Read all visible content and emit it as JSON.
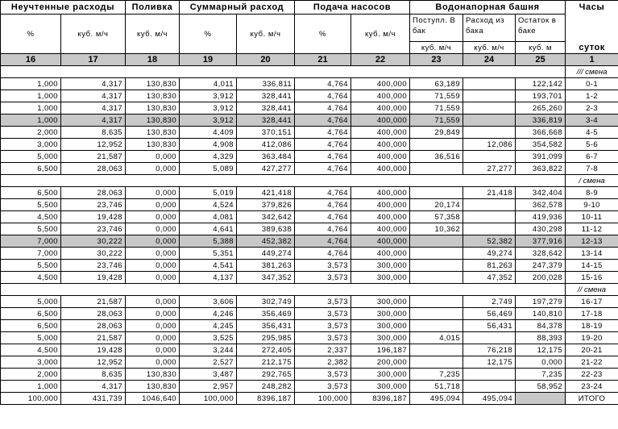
{
  "headers": {
    "unaccounted": "Неучтенные расходы",
    "watering": "Поливка",
    "total_flow": "Суммарный расход",
    "pumps": "Подача насосов",
    "tower": "Водонапорная башня",
    "hours": "Часы",
    "day": "суток",
    "pct": "%",
    "m3h": "куб. м/ч",
    "m3": "куб. м",
    "tower_in": "Поступл. В бак",
    "tower_out": "Расход из бака",
    "tower_rest": "Остаток в баке",
    "column_numbers": [
      "16",
      "17",
      "18",
      "19",
      "20",
      "21",
      "22",
      "23",
      "24",
      "25",
      "1"
    ]
  },
  "shifts": [
    {
      "label": "/// смена",
      "rows": [
        {
          "c16": "1,000",
          "c17": "4,317",
          "c18": "130,830",
          "c19": "4,011",
          "c20": "336,811",
          "c21": "4,764",
          "c22": "400,000",
          "c23": "63,189",
          "c24": "",
          "c25": "122,142",
          "t": "0-1"
        },
        {
          "c16": "1,000",
          "c17": "4,317",
          "c18": "130,830",
          "c19": "3,912",
          "c20": "328,441",
          "c21": "4,764",
          "c22": "400,000",
          "c23": "71,559",
          "c24": "",
          "c25": "193,701",
          "t": "1-2"
        },
        {
          "c16": "1,000",
          "c17": "4,317",
          "c18": "130,830",
          "c19": "3,912",
          "c20": "328,441",
          "c21": "4,764",
          "c22": "400,000",
          "c23": "71,559",
          "c24": "",
          "c25": "265,260",
          "t": "2-3"
        },
        {
          "c16": "1,000",
          "c17": "4,317",
          "c18": "130,830",
          "c19": "3,912",
          "c20": "328,441",
          "c21": "4,764",
          "c22": "400,000",
          "c23": "71,559",
          "c24": "",
          "c25": "336,819",
          "t": "3-4",
          "hl": true
        },
        {
          "c16": "2,000",
          "c17": "8,635",
          "c18": "130,830",
          "c19": "4,409",
          "c20": "370,151",
          "c21": "4,764",
          "c22": "400,000",
          "c23": "29,849",
          "c24": "",
          "c25": "366,668",
          "t": "4-5"
        },
        {
          "c16": "3,000",
          "c17": "12,952",
          "c18": "130,830",
          "c19": "4,908",
          "c20": "412,086",
          "c21": "4,764",
          "c22": "400,000",
          "c23": "",
          "c24": "12,086",
          "c25": "354,582",
          "t": "5-6"
        },
        {
          "c16": "5,000",
          "c17": "21,587",
          "c18": "0,000",
          "c19": "4,329",
          "c20": "363,484",
          "c21": "4,764",
          "c22": "400,000",
          "c23": "36,516",
          "c24": "",
          "c25": "391,099",
          "t": "6-7"
        },
        {
          "c16": "6,500",
          "c17": "28,063",
          "c18": "0,000",
          "c19": "5,089",
          "c20": "427,277",
          "c21": "4,764",
          "c22": "400,000",
          "c23": "",
          "c24": "27,277",
          "c25": "363,822",
          "t": "7-8"
        }
      ]
    },
    {
      "label": "/ смена",
      "rows": [
        {
          "c16": "6,500",
          "c17": "28,063",
          "c18": "0,000",
          "c19": "5,019",
          "c20": "421,418",
          "c21": "4,764",
          "c22": "400,000",
          "c23": "",
          "c24": "21,418",
          "c25": "342,404",
          "t": "8-9"
        },
        {
          "c16": "5,500",
          "c17": "23,746",
          "c18": "0,000",
          "c19": "4,524",
          "c20": "379,826",
          "c21": "4,764",
          "c22": "400,000",
          "c23": "20,174",
          "c24": "",
          "c25": "362,578",
          "t": "9-10"
        },
        {
          "c16": "4,500",
          "c17": "19,428",
          "c18": "0,000",
          "c19": "4,081",
          "c20": "342,642",
          "c21": "4,764",
          "c22": "400,000",
          "c23": "57,358",
          "c24": "",
          "c25": "419,936",
          "t": "10-11"
        },
        {
          "c16": "5,500",
          "c17": "23,746",
          "c18": "0,000",
          "c19": "4,641",
          "c20": "389,638",
          "c21": "4,764",
          "c22": "400,000",
          "c23": "10,362",
          "c24": "",
          "c25": "430,298",
          "t": "11-12"
        },
        {
          "c16": "7,000",
          "c17": "30,222",
          "c18": "0,000",
          "c19": "5,388",
          "c20": "452,382",
          "c21": "4,764",
          "c22": "400,000",
          "c23": "",
          "c24": "52,382",
          "c25": "377,916",
          "t": "12-13",
          "hl": true
        },
        {
          "c16": "7,000",
          "c17": "30,222",
          "c18": "0,000",
          "c19": "5,351",
          "c20": "449,274",
          "c21": "4,764",
          "c22": "400,000",
          "c23": "",
          "c24": "49,274",
          "c25": "328,642",
          "t": "13-14"
        },
        {
          "c16": "5,500",
          "c17": "23,746",
          "c18": "0,000",
          "c19": "4,541",
          "c20": "381,263",
          "c21": "3,573",
          "c22": "300,000",
          "c23": "",
          "c24": "81,263",
          "c25": "247,379",
          "t": "14-15"
        },
        {
          "c16": "4,500",
          "c17": "19,428",
          "c18": "0,000",
          "c19": "4,137",
          "c20": "347,352",
          "c21": "3,573",
          "c22": "300,000",
          "c23": "",
          "c24": "47,352",
          "c25": "200,028",
          "t": "15-16"
        }
      ]
    },
    {
      "label": "// смена",
      "rows": [
        {
          "c16": "5,000",
          "c17": "21,587",
          "c18": "0,000",
          "c19": "3,606",
          "c20": "302,749",
          "c21": "3,573",
          "c22": "300,000",
          "c23": "",
          "c24": "2,749",
          "c25": "197,279",
          "t": "16-17"
        },
        {
          "c16": "6,500",
          "c17": "28,063",
          "c18": "0,000",
          "c19": "4,246",
          "c20": "356,469",
          "c21": "3,573",
          "c22": "300,000",
          "c23": "",
          "c24": "56,469",
          "c25": "140,810",
          "t": "17-18"
        },
        {
          "c16": "6,500",
          "c17": "28,063",
          "c18": "0,000",
          "c19": "4,245",
          "c20": "356,431",
          "c21": "3,573",
          "c22": "300,000",
          "c23": "",
          "c24": "56,431",
          "c25": "84,378",
          "t": "18-19"
        },
        {
          "c16": "5,000",
          "c17": "21,587",
          "c18": "0,000",
          "c19": "3,525",
          "c20": "295,985",
          "c21": "3,573",
          "c22": "300,000",
          "c23": "4,015",
          "c24": "",
          "c25": "88,393",
          "t": "19-20"
        },
        {
          "c16": "4,500",
          "c17": "19,428",
          "c18": "0,000",
          "c19": "3,244",
          "c20": "272,405",
          "c21": "2,337",
          "c22": "196,187",
          "c23": "",
          "c24": "76,218",
          "c25": "12,175",
          "t": "20-21"
        },
        {
          "c16": "3,000",
          "c17": "12,952",
          "c18": "0,000",
          "c19": "2,527",
          "c20": "212,175",
          "c21": "2,382",
          "c22": "200,000",
          "c23": "",
          "c24": "12,175",
          "c25": "0,000",
          "t": "21-22"
        },
        {
          "c16": "2,000",
          "c17": "8,635",
          "c18": "130,830",
          "c19": "3,487",
          "c20": "292,765",
          "c21": "3,573",
          "c22": "300,000",
          "c23": "7,235",
          "c24": "",
          "c25": "7,235",
          "t": "22-23"
        },
        {
          "c16": "1,000",
          "c17": "4,317",
          "c18": "130,830",
          "c19": "2,957",
          "c20": "248,282",
          "c21": "3,573",
          "c22": "300,000",
          "c23": "51,718",
          "c24": "",
          "c25": "58,952",
          "t": "23-24"
        }
      ]
    }
  ],
  "totals": {
    "c16": "100,000",
    "c17": "431,739",
    "c18": "1046,640",
    "c19": "100,000",
    "c20": "8396,187",
    "c21": "100,000",
    "c22": "8396,187",
    "c23": "495,094",
    "c24": "495,094",
    "c25": "",
    "t": "ИТОГО"
  }
}
